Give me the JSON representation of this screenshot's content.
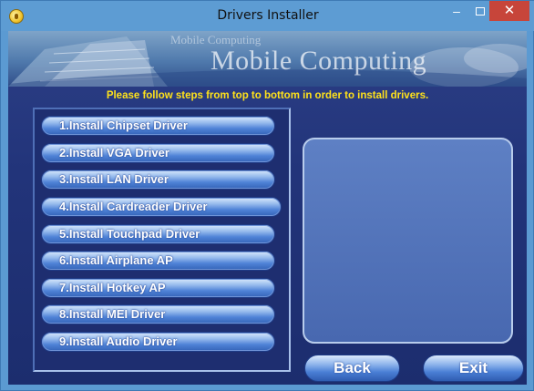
{
  "window": {
    "title": "Drivers Installer",
    "controls": {
      "minimize": "–",
      "close": "✕"
    }
  },
  "banner": {
    "small_text": "Mobile Computing",
    "main_text": "Mobile Computing"
  },
  "instruction": "Please follow steps from top to bottom in order to install drivers.",
  "drivers": [
    "1.Install Chipset Driver",
    "2.Install VGA Driver",
    "3.Install LAN Driver",
    "4.Install Cardreader Driver",
    "5.Install Touchpad Driver",
    "6.Install Airplane AP",
    "7.Install Hotkey AP",
    "8.Install MEI Driver",
    "9.Install Audio Driver"
  ],
  "buttons": {
    "back": "Back",
    "exit": "Exit"
  },
  "colors": {
    "instruction": "#ffe21a",
    "close": "#c7453a",
    "titlebar": "#5d9cd3"
  }
}
